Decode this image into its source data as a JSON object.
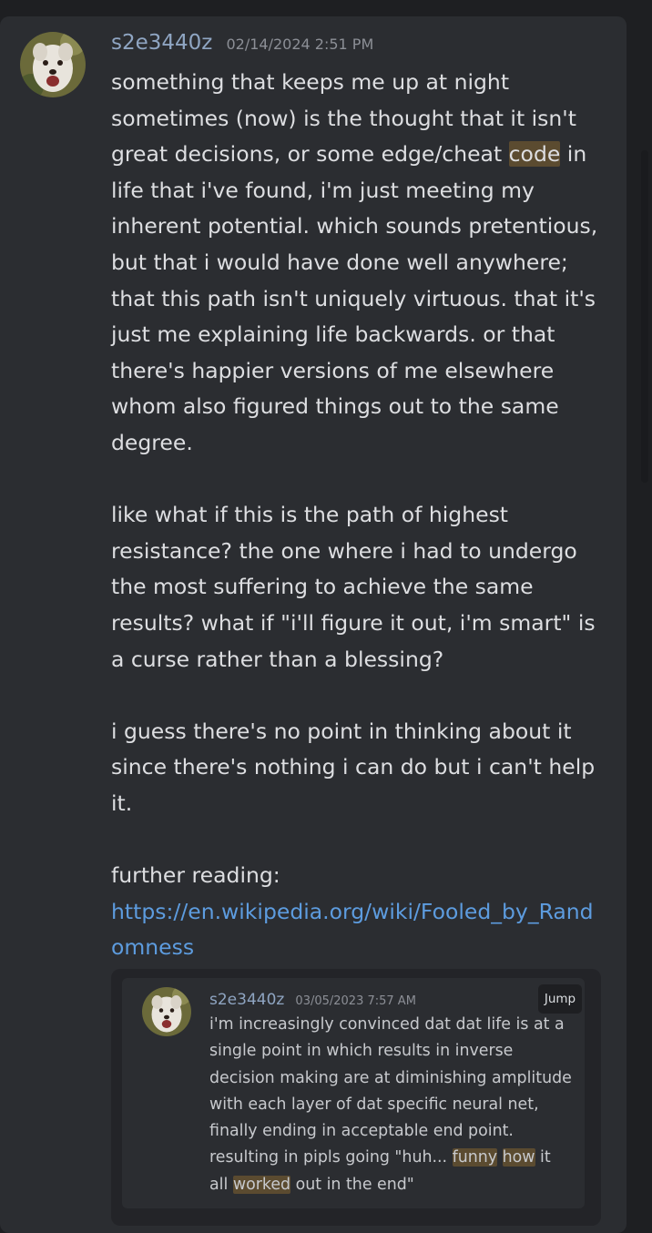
{
  "message": {
    "username": "s2e3440z",
    "timestamp": "02/14/2024 2:51 PM",
    "avatar_icon": "dog-avatar-icon",
    "paragraphs": [
      {
        "segments": [
          {
            "text": "something that keeps me up at night sometimes (now) is the thought that it isn't great decisions, or some edge/cheat "
          },
          {
            "text": "code",
            "highlight": true
          },
          {
            "text": " in life that i've found, i'm just meeting my inherent potential. which sounds pretentious, but that i would have done well anywhere; that this path isn't uniquely virtuous. that it's just me explaining life backwards. or that there's happier versions of me elsewhere whom also figured things out to the same degree."
          }
        ]
      },
      {
        "segments": [
          {
            "text": "like what if this is the path of highest resistance? the one where i had to undergo the most suffering to achieve the same results? what if \"i'll figure it out, i'm smart\" is a curse rather than a blessing?"
          }
        ]
      },
      {
        "segments": [
          {
            "text": "i guess there's no point in thinking about it since there's nothing i can do but i can't help it."
          }
        ]
      },
      {
        "segments": [
          {
            "text": "further reading:"
          }
        ]
      }
    ],
    "link": "https://en.wikipedia.org/wiki/Fooled_by_Randomness"
  },
  "quote": {
    "username": "s2e3440z",
    "timestamp": "03/05/2023 7:57 AM",
    "jump_label": "Jump",
    "segments": [
      {
        "text": "i'm increasingly convinced dat dat life is at a single point in which results in inverse decision making are at diminishing amplitude with each layer of dat specific neural net, finally ending in acceptable end point. resulting in pipls going \"huh... "
      },
      {
        "text": "funny",
        "highlight": true
      },
      {
        "text": " "
      },
      {
        "text": "how",
        "highlight": true
      },
      {
        "text": " it all "
      },
      {
        "text": "worked",
        "highlight": true
      },
      {
        "text": " out in the end\""
      }
    ]
  },
  "colors": {
    "background": "#1e1f22",
    "card": "#2b2d31",
    "username": "#8fa5c2",
    "link": "#5d9cdf",
    "highlight": "#5b4b30"
  }
}
